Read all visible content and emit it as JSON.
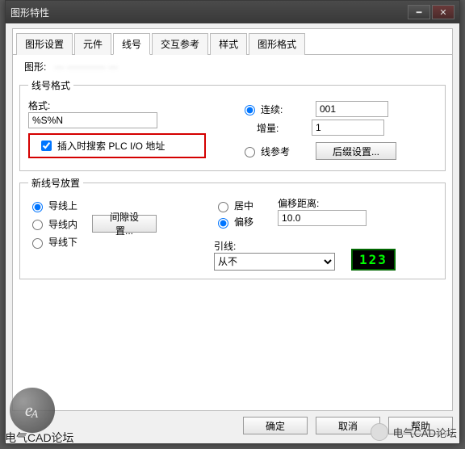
{
  "window": {
    "title": "图形特性"
  },
  "tabs": {
    "items": [
      "图形设置",
      "元件",
      "线号",
      "交互参考",
      "样式",
      "图形格式"
    ],
    "active_index": 2
  },
  "drawing_row": {
    "label": "图形:",
    "value": "··· ············ ···"
  },
  "wire_format": {
    "legend": "线号格式",
    "format_label": "格式:",
    "format_value": "%S%N",
    "checkbox_label": "插入时搜索 PLC I/O 地址",
    "checkbox_checked": true,
    "seq_label": "连续:",
    "seq_value": "001",
    "incr_label": "增量:",
    "incr_value": "1",
    "ref_label": "线参考",
    "suffix_btn": "后缀设置..."
  },
  "placement": {
    "legend": "新线号放置",
    "on_line": "导线上",
    "in_line": "导线内",
    "below_line": "导线下",
    "gap_btn": "间隙设置...",
    "center": "居中",
    "offset": "偏移",
    "offset_dist_label": "偏移距离:",
    "offset_dist_value": "10.0",
    "leader_label": "引线:",
    "leader_value": "从不",
    "preview": "123"
  },
  "buttons": {
    "ok": "确定",
    "cancel": "取消",
    "help": "帮助"
  },
  "watermark": {
    "logo1": "e",
    "logo2": "A",
    "text_left": "电气CAD论坛",
    "text_right": "电气CAD论坛"
  }
}
